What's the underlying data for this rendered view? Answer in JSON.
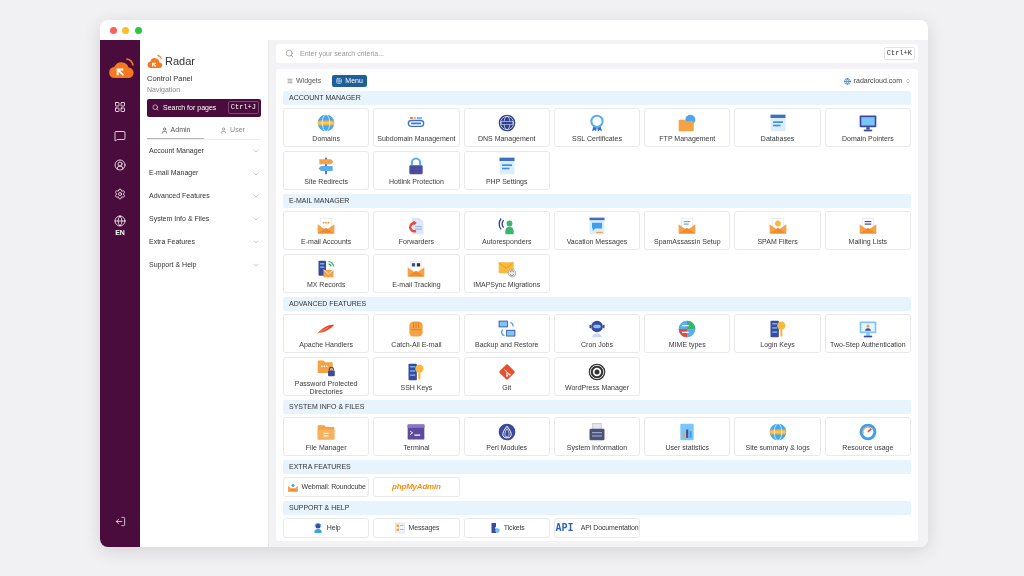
{
  "rail": {
    "language": "EN"
  },
  "brand": {
    "name": "Radar",
    "title": "Control Panel",
    "subtitle": "Navigation"
  },
  "sidebar_search": {
    "placeholder": "Search for pages",
    "shortcut": "Ctrl+J"
  },
  "role_tabs": [
    {
      "label": "Admin",
      "selected": true
    },
    {
      "label": "User",
      "selected": false
    }
  ],
  "sidebar": {
    "items": [
      {
        "label": "Account Manager",
        "expanded": false
      },
      {
        "label": "E-mail Manager",
        "expanded": false
      },
      {
        "label": "Advanced Features",
        "expanded": false
      },
      {
        "label": "System Info & Files",
        "expanded": false
      },
      {
        "label": "Extra Features",
        "expanded": false
      },
      {
        "label": "Support & Help",
        "expanded": false
      }
    ]
  },
  "search": {
    "placeholder": "Enter your search criteria...",
    "shortcut": "Ctrl+K"
  },
  "view_tabs": [
    {
      "label": "Widgets",
      "selected": false
    },
    {
      "label": "Menu",
      "selected": true
    }
  ],
  "domain_select": {
    "value": "radarcloud.com"
  },
  "sections": [
    {
      "title": "ACCOUNT MANAGER",
      "kind": "tiles",
      "items": [
        {
          "label": "Domains"
        },
        {
          "label": "Subdomain Management"
        },
        {
          "label": "DNS Management"
        },
        {
          "label": "SSL Certificates"
        },
        {
          "label": "FTP Management"
        },
        {
          "label": "Databases"
        },
        {
          "label": "Domain Pointers"
        },
        {
          "label": "Site Redirects"
        },
        {
          "label": "Hotlink Protection"
        },
        {
          "label": "PHP Settings"
        }
      ]
    },
    {
      "title": "E-MAIL MANAGER",
      "kind": "tiles",
      "items": [
        {
          "label": "E-mail Accounts"
        },
        {
          "label": "Forwarders"
        },
        {
          "label": "Autoresponders"
        },
        {
          "label": "Vacation Messages"
        },
        {
          "label": "SpamAssassin Setup"
        },
        {
          "label": "SPAM Filters"
        },
        {
          "label": "Mailing Lists"
        },
        {
          "label": "MX Records"
        },
        {
          "label": "E-mail Tracking"
        },
        {
          "label": "IMAPSync Migrations"
        }
      ]
    },
    {
      "title": "ADVANCED FEATURES",
      "kind": "tiles",
      "items": [
        {
          "label": "Apache Handlers"
        },
        {
          "label": "Catch-All E-mail"
        },
        {
          "label": "Backup and Restore"
        },
        {
          "label": "Cron Jobs"
        },
        {
          "label": "MIME types"
        },
        {
          "label": "Login Keys"
        },
        {
          "label": "Two-Step Authentication"
        },
        {
          "label": "Password Protected Directories"
        },
        {
          "label": "SSH Keys"
        },
        {
          "label": "Git"
        },
        {
          "label": "WordPress Manager"
        }
      ]
    },
    {
      "title": "SYSTEM INFO & FILES",
      "kind": "tiles",
      "items": [
        {
          "label": "File Manager"
        },
        {
          "label": "Terminal"
        },
        {
          "label": "Perl Modules"
        },
        {
          "label": "System Information"
        },
        {
          "label": "User statistics"
        },
        {
          "label": "Site summary & logs"
        },
        {
          "label": "Resource usage"
        }
      ]
    },
    {
      "title": "EXTRA FEATURES",
      "kind": "inline",
      "items": [
        {
          "label": "Webmail: Roundcube",
          "kind": "icon"
        },
        {
          "label": "phpMyAdmin",
          "kind": "logo"
        }
      ]
    },
    {
      "title": "SUPPORT & HELP",
      "kind": "inline",
      "items": [
        {
          "label": "Help"
        },
        {
          "label": "Messages"
        },
        {
          "label": "Tickets"
        },
        {
          "label": "API Documentation",
          "icon_text": "API"
        }
      ]
    }
  ]
}
